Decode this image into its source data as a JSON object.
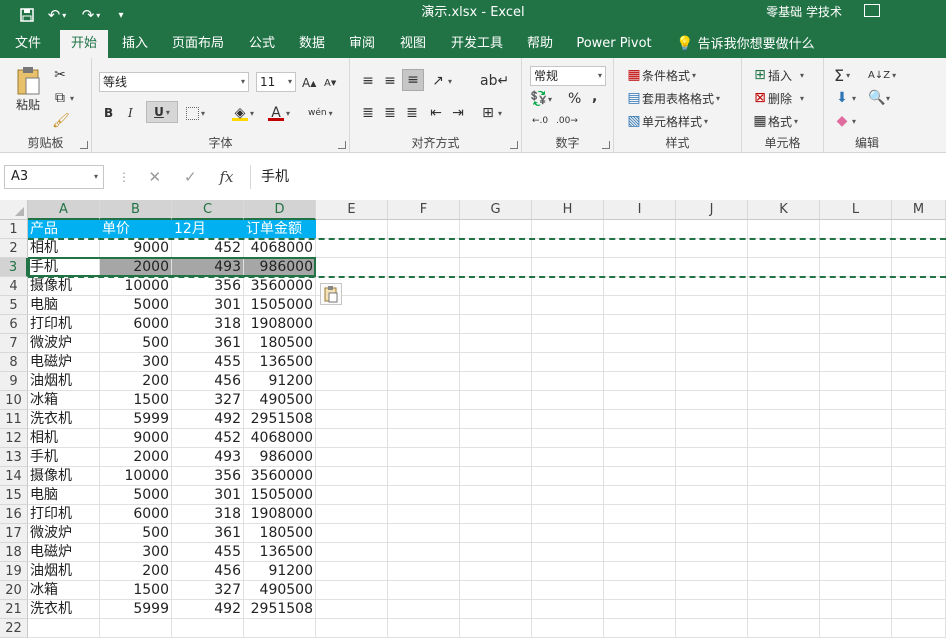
{
  "window": {
    "title": "演示.xlsx - Excel",
    "account": "零基础 学技术",
    "qat": {
      "save_icon": "save-icon",
      "undo_icon": "undo-icon",
      "redo_icon": "redo-icon",
      "customize_icon": "qat-customize-icon"
    }
  },
  "menu": {
    "tabs": [
      "文件",
      "开始",
      "插入",
      "页面布局",
      "公式",
      "数据",
      "审阅",
      "视图",
      "开发工具",
      "帮助",
      "Power Pivot"
    ],
    "active": "开始",
    "tell_me": "告诉我你想要做什么"
  },
  "ribbon": {
    "clipboard": {
      "label": "剪贴板",
      "paste": "粘贴"
    },
    "font": {
      "label": "字体",
      "font_name": "等线",
      "font_size": "11",
      "bold": "B",
      "italic": "I",
      "underline": "U",
      "phonetic": "wén"
    },
    "alignment": {
      "label": "对齐方式"
    },
    "number": {
      "label": "数字",
      "format": "常规",
      "percent": "%",
      "comma": ","
    },
    "styles": {
      "label": "样式",
      "conditional": "条件格式",
      "table": "套用表格格式",
      "cell_styles": "单元格样式"
    },
    "cells": {
      "label": "单元格",
      "insert": "插入",
      "delete": "删除",
      "format": "格式"
    },
    "editing": {
      "label": "编辑"
    }
  },
  "formula_bar": {
    "name_box": "A3",
    "fx": "fx",
    "value": "手机"
  },
  "sheet": {
    "columns": [
      "A",
      "B",
      "C",
      "D",
      "E",
      "F",
      "G",
      "H",
      "I",
      "J",
      "K",
      "L",
      "M"
    ],
    "header": [
      "产品",
      "单价",
      "12月",
      "订单金额"
    ],
    "rows": [
      [
        "相机",
        "9000",
        "452",
        "4068000"
      ],
      [
        "手机",
        "2000",
        "493",
        "986000"
      ],
      [
        "摄像机",
        "10000",
        "356",
        "3560000"
      ],
      [
        "电脑",
        "5000",
        "301",
        "1505000"
      ],
      [
        "打印机",
        "6000",
        "318",
        "1908000"
      ],
      [
        "微波炉",
        "500",
        "361",
        "180500"
      ],
      [
        "电磁炉",
        "300",
        "455",
        "136500"
      ],
      [
        "油烟机",
        "200",
        "456",
        "91200"
      ],
      [
        "冰箱",
        "1500",
        "327",
        "490500"
      ],
      [
        "洗衣机",
        "5999",
        "492",
        "2951508"
      ],
      [
        "相机",
        "9000",
        "452",
        "4068000"
      ],
      [
        "手机",
        "2000",
        "493",
        "986000"
      ],
      [
        "摄像机",
        "10000",
        "356",
        "3560000"
      ],
      [
        "电脑",
        "5000",
        "301",
        "1505000"
      ],
      [
        "打印机",
        "6000",
        "318",
        "1908000"
      ],
      [
        "微波炉",
        "500",
        "361",
        "180500"
      ],
      [
        "电磁炉",
        "300",
        "455",
        "136500"
      ],
      [
        "油烟机",
        "200",
        "456",
        "91200"
      ],
      [
        "冰箱",
        "1500",
        "327",
        "490500"
      ],
      [
        "洗衣机",
        "5999",
        "492",
        "2951508"
      ]
    ],
    "row_numbers": [
      "1",
      "2",
      "3",
      "4",
      "5",
      "6",
      "7",
      "8",
      "9",
      "10",
      "11",
      "12",
      "13",
      "14",
      "15",
      "16",
      "17",
      "18",
      "19",
      "20",
      "21",
      "22"
    ],
    "selected_row": 3,
    "header_color": "#00b0f0",
    "accent_color": "#217346"
  }
}
